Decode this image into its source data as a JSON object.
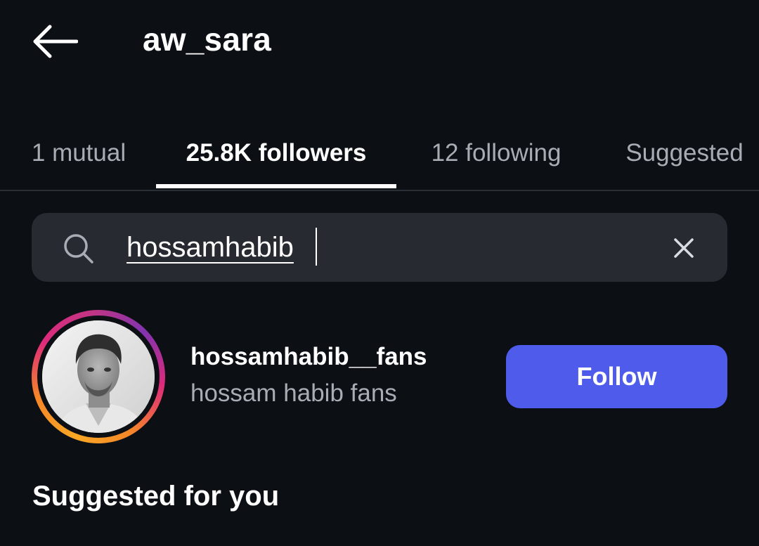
{
  "header": {
    "title": "aw_sara"
  },
  "tabs": [
    {
      "label": "1 mutual",
      "active": false
    },
    {
      "label": "25.8K followers",
      "active": true
    },
    {
      "label": "12 following",
      "active": false
    },
    {
      "label": "Suggested",
      "active": false
    }
  ],
  "search": {
    "value": "hossamhabib",
    "icon": "search-icon",
    "clear_icon": "close-icon"
  },
  "result": {
    "username": "hossamhabib__fans",
    "full_name": "hossam habib fans",
    "follow_label": "Follow"
  },
  "suggested": {
    "title": "Suggested for you"
  },
  "colors": {
    "background": "#0c0f14",
    "search_bg": "#272a30",
    "follow_button": "#4f5ceb",
    "muted_text": "#a8adb5"
  }
}
